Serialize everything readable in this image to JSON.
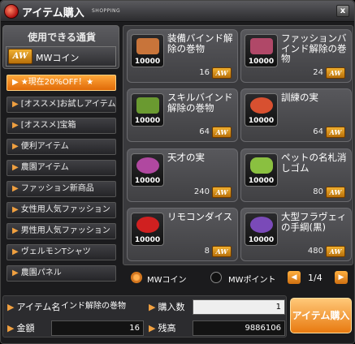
{
  "window": {
    "title": "アイテム購入",
    "subtitle": "SHOPPING",
    "close_label": "x"
  },
  "currency": {
    "label": "使用できる通貨",
    "icon_text": "AW",
    "name": "MWコイン"
  },
  "categories": [
    "★現在20%OFF！★",
    "[オススメ]お試しアイテム",
    "[オススメ]宝箱",
    "便利アイテム",
    "農園アイテム",
    "ファッション新商品",
    "女性用人気ファッション",
    "男性用人気ファッション",
    "ヴェルモンTシャツ",
    "農園パネル"
  ],
  "items": [
    {
      "name": "装備バインド解除の巻物",
      "price": "10000",
      "qty": "16",
      "color": "#c8743a"
    },
    {
      "name": "ファッションバインド解除の巻物",
      "price": "10000",
      "qty": "24",
      "color": "#b04868"
    },
    {
      "name": "スキルバインド解除の巻物",
      "price": "10000",
      "qty": "64",
      "color": "#6a9a30"
    },
    {
      "name": "訓練の実",
      "price": "10000",
      "qty": "64",
      "color": "#d85030"
    },
    {
      "name": "天才の実",
      "price": "10000",
      "qty": "240",
      "color": "#b048a0"
    },
    {
      "name": "ペットの名札消しゴム",
      "price": "10000",
      "qty": "80",
      "color": "#8ac040"
    },
    {
      "name": "リモコンダイス",
      "price": "10000",
      "qty": "8",
      "color": "#d02020"
    },
    {
      "name": "大型フラヴェィの手綱(黒)",
      "price": "10000",
      "qty": "480",
      "color": "#7a4ab8"
    }
  ],
  "aw_badge": "AW",
  "payment": {
    "option1": "MWコイン",
    "option2": "MWポイント",
    "page": "1/4"
  },
  "bottom": {
    "item_name_label": "アイテム名",
    "item_name_value": "インド解除の巻物",
    "quantity_label": "購入数",
    "quantity_value": "1",
    "amount_label": "金額",
    "amount_value": "16",
    "balance_label": "残高",
    "balance_value": "9886106",
    "buy_label": "アイテム購入"
  },
  "colors": {
    "accent": "#f08a1e",
    "panel": "#3a3a3d"
  }
}
